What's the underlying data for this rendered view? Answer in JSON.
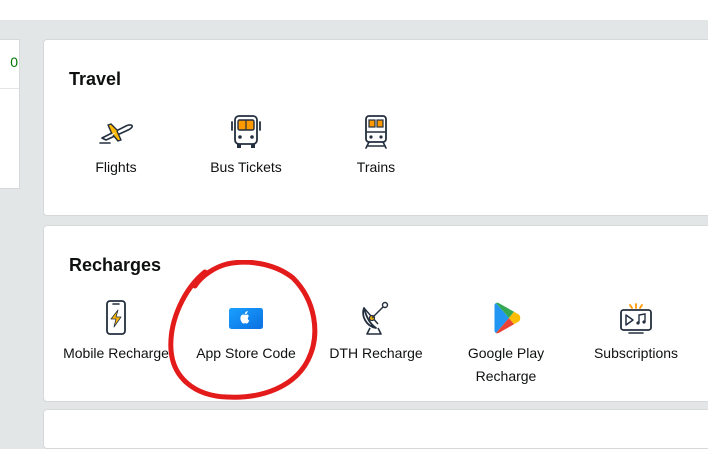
{
  "left_card": {
    "value": "0",
    "value_color": "#007600"
  },
  "travel": {
    "title": "Travel",
    "items": [
      {
        "label": "Flights",
        "icon": "airplane-icon"
      },
      {
        "label": "Bus Tickets",
        "icon": "bus-icon"
      },
      {
        "label": "Trains",
        "icon": "train-icon"
      }
    ]
  },
  "recharges": {
    "title": "Recharges",
    "items": [
      {
        "label": "Mobile Recharge",
        "icon": "mobile-phone-icon"
      },
      {
        "label": "App Store Code",
        "icon": "apple-gift-card-icon"
      },
      {
        "label": "DTH Recharge",
        "icon": "satellite-dish-icon"
      },
      {
        "label": "Google Play Recharge",
        "icon": "google-play-icon"
      },
      {
        "label": "Subscriptions",
        "icon": "subscription-tv-icon"
      }
    ]
  },
  "colors": {
    "accent": "#ff9900",
    "icon_blue": "#232f3e",
    "annotation": "#e31b1b"
  }
}
